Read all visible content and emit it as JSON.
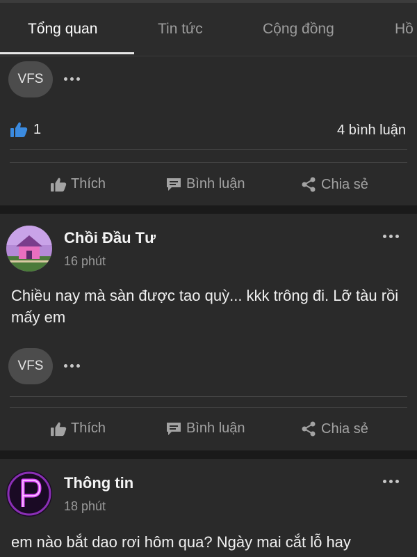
{
  "tabs": [
    {
      "label": "Tổng quan",
      "active": true
    },
    {
      "label": "Tin tức",
      "active": false
    },
    {
      "label": "Cộng đồng",
      "active": false
    },
    {
      "label": "Hồ",
      "active": false
    }
  ],
  "chip_label": "VFS",
  "actions": {
    "like": "Thích",
    "comment": "Bình luận",
    "share": "Chia sẻ"
  },
  "post0": {
    "like_count": "1",
    "comment_count": "4 bình luận"
  },
  "post1": {
    "author": "Chồi Đầu Tư",
    "time": "16 phút",
    "text": "Chiều nay mà sàn được tao quỳ... kkk trông đi. Lỡ tàu rồi mấy em"
  },
  "post2": {
    "author": "Thông tin",
    "time": "18 phút",
    "text": "em nào bắt dao rơi hôm qua? Ngày mai cắt lỗ hay"
  },
  "colors": {
    "background": "#1a1a1a",
    "card": "#2a2a2a",
    "like_blue": "#3b8be0",
    "neon_purple": "#e04bff"
  },
  "icons": [
    "more-icon",
    "thumbs-up-icon",
    "comment-icon",
    "share-icon"
  ]
}
